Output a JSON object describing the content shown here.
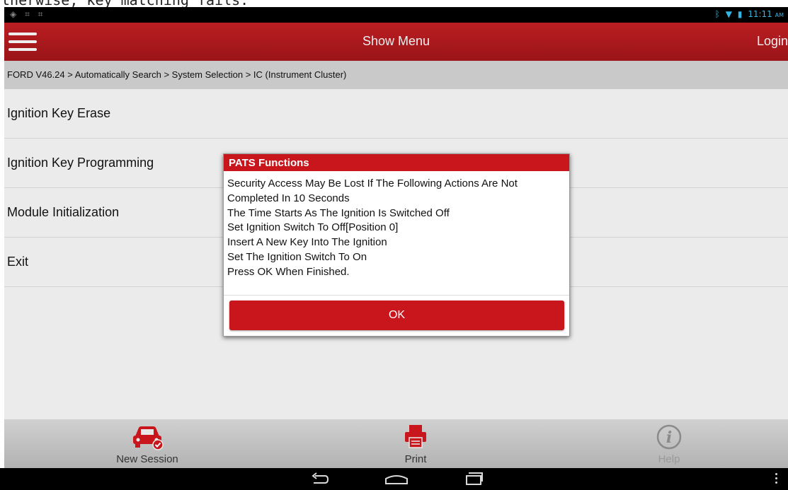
{
  "top_strip_text": "therwise, key matching fails.",
  "status_bar": {
    "notification_icons": [
      "location-icon",
      "screenshot-icon",
      "screenshot-icon"
    ],
    "system_icons": [
      "bluetooth-icon",
      "wifi-icon",
      "battery-icon"
    ],
    "time": "11:11",
    "ampm": "AM"
  },
  "header": {
    "title": "Show Menu",
    "login_label": "Login",
    "accent_color": "#b01b1f"
  },
  "breadcrumb": "FORD V46.24 > Automatically Search > System Selection > IC (Instrument Cluster)",
  "menu_items": [
    "Ignition Key Erase",
    "Ignition Key Programming",
    "Module Initialization",
    "Exit"
  ],
  "dialog": {
    "title": "PATS Functions",
    "lines": [
      "Security Access May Be Lost If The Following Actions Are Not",
      "Completed In 10 Seconds",
      "The Time Starts As The Ignition Is Switched Off",
      "Set Ignition Switch To Off[Position 0]",
      "Insert A New Key Into The Ignition",
      "Set The Ignition Switch To On",
      "Press OK When Finished."
    ],
    "ok_label": "OK",
    "button_color": "#c8161c"
  },
  "bottom_bar": {
    "new_session": {
      "label": "New Session",
      "icon": "car-check-icon"
    },
    "print": {
      "label": "Print",
      "icon": "printer-icon"
    },
    "help": {
      "label": "Help",
      "icon": "info-icon",
      "disabled": true
    }
  },
  "nav_bar": {
    "icons": [
      "back-icon",
      "home-icon",
      "recent-apps-icon",
      "overflow-menu-icon"
    ]
  }
}
